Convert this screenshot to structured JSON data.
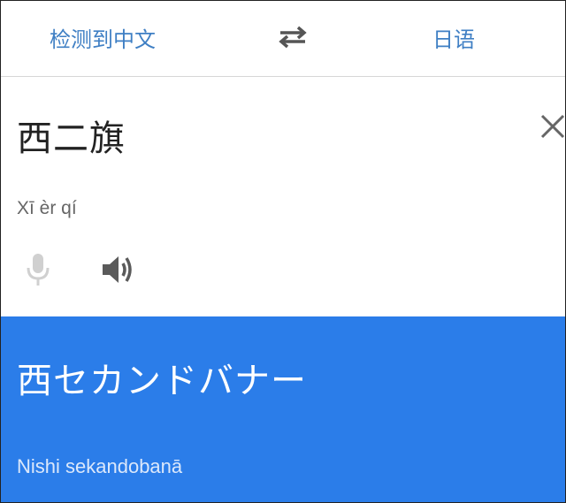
{
  "lang_bar": {
    "source_lang": "检测到中文",
    "target_lang": "日语"
  },
  "input": {
    "source_text": "西二旗",
    "pinyin": "Xī èr qí"
  },
  "result": {
    "translation": "西セカンドバナー",
    "romanization": "Nishi sekandobanā"
  },
  "icons": {
    "swap": "swap-arrows-icon",
    "clear": "close-icon",
    "mic": "microphone-icon",
    "speaker": "speaker-icon"
  },
  "colors": {
    "accent": "#3f7fc4",
    "result_bg": "#2b7de9"
  }
}
